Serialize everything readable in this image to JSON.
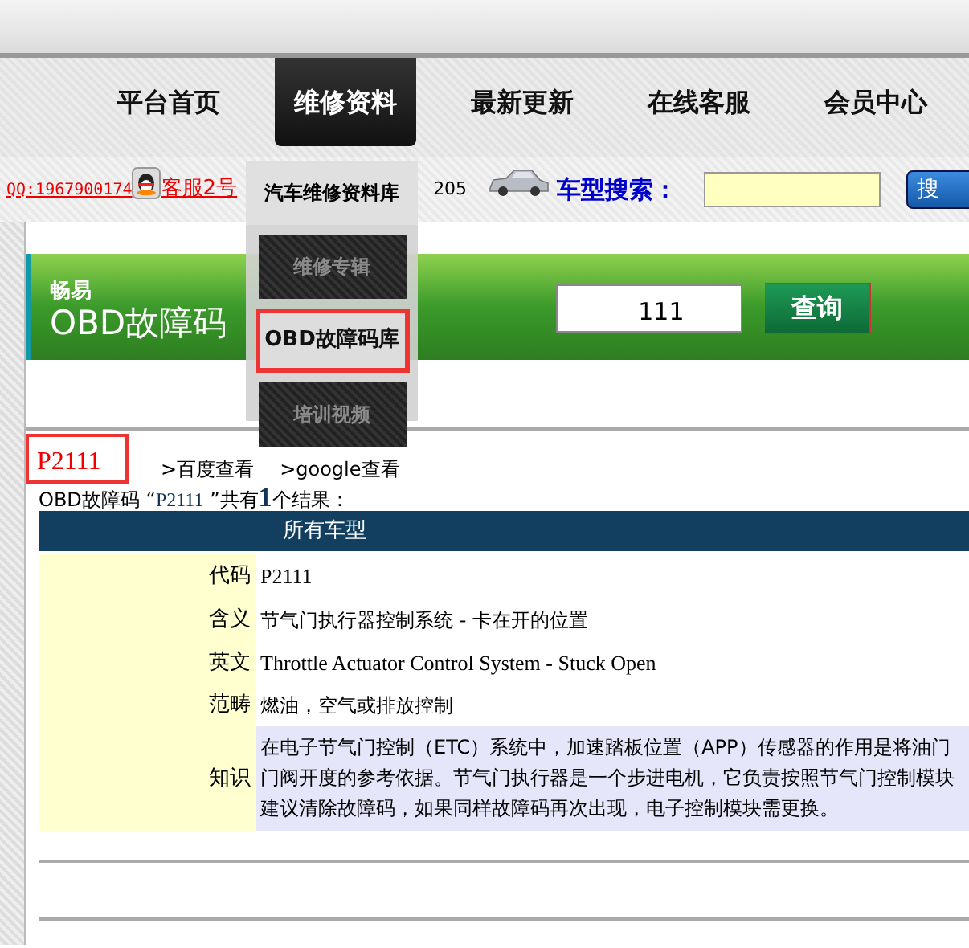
{
  "nav": [
    {
      "label": "平台首页",
      "selected": false
    },
    {
      "label": "维修资料",
      "selected": true
    },
    {
      "label": "最新更新",
      "selected": false
    },
    {
      "label": "在线客服",
      "selected": false
    },
    {
      "label": "会员中心",
      "selected": false
    }
  ],
  "dropdown": [
    {
      "label": "汽车维修资料库",
      "kind": "header",
      "selected": false
    },
    {
      "label": "维修专辑",
      "kind": "tile",
      "selected": false
    },
    {
      "label": "OBD故障码库",
      "kind": "tile",
      "selected": true
    },
    {
      "label": "培训视频",
      "kind": "tile",
      "selected": false
    }
  ],
  "contact": {
    "qq": "QQ:1967900174",
    "service": "客服2号",
    "hotline_tail": "205"
  },
  "car_search": {
    "label": "车型搜索：",
    "button": "搜"
  },
  "obd_banner": {
    "brand": "畅易",
    "title": "OBD故障码",
    "query": "111",
    "button": "查询"
  },
  "result": {
    "code": "P2111",
    "links": [
      ">百度查看",
      ">google查看"
    ],
    "summary": {
      "before": "OBD故障码 “",
      "code": "P2111",
      "after": " ”共有**1**个结果："
    }
  },
  "table": {
    "header": "所有车型",
    "rows": [
      {
        "label": "代码",
        "kind": "latin",
        "value": "P2111"
      },
      {
        "label": "含义",
        "kind": "text",
        "value": "节气门执行器控制系统 - 卡在开的位置"
      },
      {
        "label": "英文",
        "kind": "latin",
        "value": "Throttle Actuator Control System - Stuck Open"
      },
      {
        "label": "范畴",
        "kind": "text",
        "value": "燃油，空气或排放控制"
      },
      {
        "label": "知识",
        "kind": "note",
        "lines": [
          "在电子节气门控制（ETC）系统中，加速踏板位置（APP）传感器的作用是将油门",
          "门阀开度的参考依据。节气门执行器是一个步进电机，它负责按照节气门控制模块",
          "建议清除故障码，如果同样故障码再次出现，电子控制模块需更换。"
        ]
      }
    ]
  }
}
